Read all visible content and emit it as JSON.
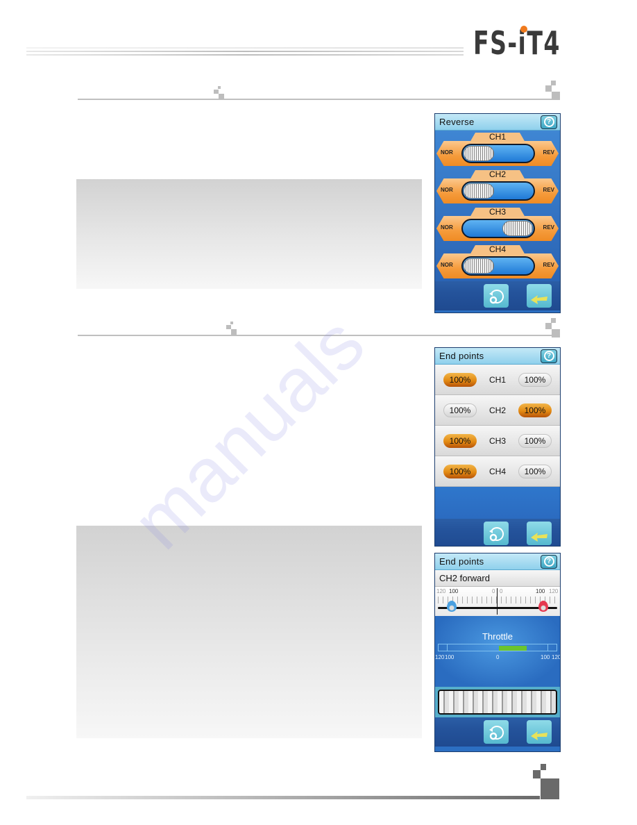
{
  "header": {
    "logo_text": "FS-iT4",
    "logo_accent_color": "#f07a1d"
  },
  "reverse_screen": {
    "title": "Reverse",
    "help_icon": "question-circle-icon",
    "channels": [
      {
        "label": "CH1",
        "left": "NOR",
        "right": "REV",
        "state": "NOR"
      },
      {
        "label": "CH2",
        "left": "NOR",
        "right": "REV",
        "state": "NOR"
      },
      {
        "label": "CH3",
        "left": "NOR",
        "right": "REV",
        "state": "REV"
      },
      {
        "label": "CH4",
        "left": "NOR",
        "right": "REV",
        "state": "NOR"
      }
    ],
    "footer": {
      "reset_icon": "reset-icon",
      "back_icon": "back-arrow-icon"
    }
  },
  "endpoints_screen": {
    "title": "End points",
    "help_icon": "question-circle-icon",
    "rows": [
      {
        "channel": "CH1",
        "low": "100%",
        "high": "100%",
        "selected": "low"
      },
      {
        "channel": "CH2",
        "low": "100%",
        "high": "100%",
        "selected": "high"
      },
      {
        "channel": "CH3",
        "low": "100%",
        "high": "100%",
        "selected": "low"
      },
      {
        "channel": "CH4",
        "low": "100%",
        "high": "100%",
        "selected": "low"
      }
    ],
    "footer": {
      "reset_icon": "reset-icon",
      "back_icon": "back-arrow-icon"
    }
  },
  "endpoint_detail_screen": {
    "title": "End points",
    "subtitle": "CH2 forward",
    "help_icon": "question-circle-icon",
    "scale_labels": {
      "left_max": "120",
      "left_val": "100",
      "left_zero": "0",
      "right_zero": "0",
      "right_val": "100",
      "right_max": "120"
    },
    "left_endpoint": 100,
    "right_endpoint": 100,
    "monitor": {
      "label": "Throttle",
      "ticks": [
        "120",
        "100",
        "0",
        "100",
        "120"
      ],
      "fill_from": 0,
      "fill_to": 50
    },
    "footer": {
      "reset_icon": "reset-icon",
      "back_icon": "back-arrow-icon"
    }
  },
  "watermark_text": "manuals"
}
